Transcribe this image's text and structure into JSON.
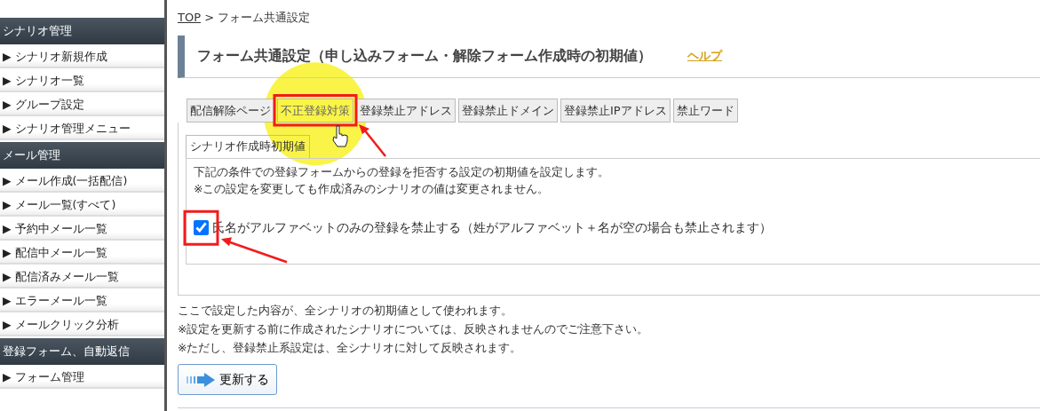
{
  "sidebar": {
    "sections": [
      {
        "title": "シナリオ管理",
        "items": [
          "▶ シナリオ新規作成",
          "▶ シナリオ一覧",
          "▶ グループ設定",
          "▶ シナリオ管理メニュー"
        ]
      },
      {
        "title": "メール管理",
        "items": [
          "▶ メール作成(一括配信)",
          "▶ メール一覧(すべて)",
          "▶ 予約中メール一覧",
          "▶ 配信中メール一覧",
          "▶ 配信済みメール一覧",
          "▶ エラーメール一覧",
          "▶ メールクリック分析"
        ]
      },
      {
        "title": "登録フォーム、自動返信",
        "items": [
          "▶ フォーム管理"
        ]
      }
    ]
  },
  "breadcrumb": {
    "link": "TOP",
    "separator": ">",
    "current": "フォーム共通設定"
  },
  "page_title": "フォーム共通設定（申し込みフォーム・解除フォーム作成時の初期値）",
  "help_link": "ヘルプ",
  "tabs": [
    {
      "label": "配信解除ページ",
      "selected": false
    },
    {
      "label": "不正登録対策",
      "selected": true
    },
    {
      "label": "登録禁止アドレス",
      "selected": false
    },
    {
      "label": "登録禁止ドメイン",
      "selected": false
    },
    {
      "label": "登録禁止IPアドレス",
      "selected": false
    },
    {
      "label": "禁止ワード",
      "selected": false
    }
  ],
  "subtab": {
    "label": "シナリオ作成時初期値",
    "selected": true
  },
  "panel": {
    "description": [
      "下記の条件での登録フォームからの登録を拒否する設定の初期値を設定します。",
      "※この設定を変更しても作成済みのシナリオの値は変更されません。"
    ],
    "option": {
      "label": "氏名がアルファベットのみの登録を禁止する（姓がアルファベット＋名が空の場合も禁止されます）",
      "checked": true
    }
  },
  "notes": [
    "ここで設定した内容が、全シナリオの初期値として使われます。",
    "※設定を更新する前に作成されたシナリオについては、反映されませんのでご注意下さい。",
    "※ただし、登録禁止系設定は、全シナリオに対して反映されます。"
  ],
  "submit_button": "更新する"
}
